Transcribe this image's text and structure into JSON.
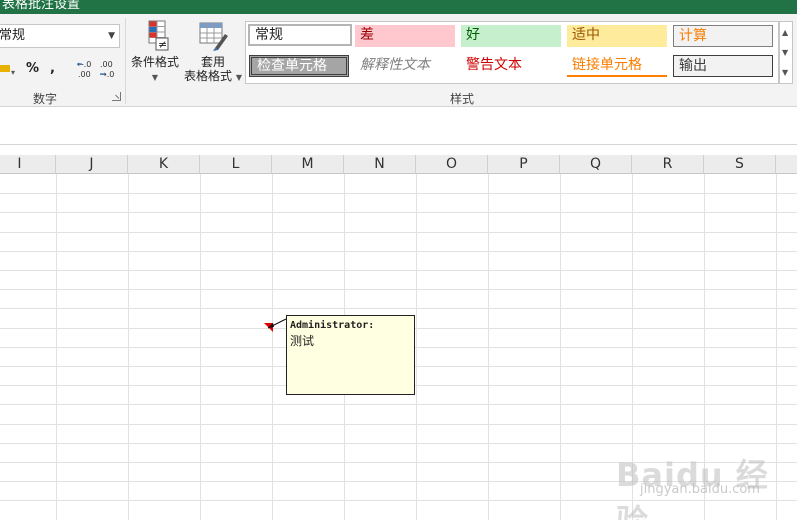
{
  "window": {
    "title": "表格批注设置"
  },
  "ribbon": {
    "number_format": "常规",
    "number_group_label": "数字",
    "percent_symbol": "%",
    "comma_symbol": ",",
    "cond_format_label": "条件格式",
    "table_format_label_1": "套用",
    "table_format_label_2": "表格格式",
    "styles_group_label": "样式",
    "styles": [
      {
        "label": "常规"
      },
      {
        "label": "差"
      },
      {
        "label": "好"
      },
      {
        "label": "适中"
      },
      {
        "label": "计算"
      },
      {
        "label": "检查单元格"
      },
      {
        "label": "解释性文本"
      },
      {
        "label": "警告文本"
      },
      {
        "label": "链接单元格"
      },
      {
        "label": "输出"
      }
    ]
  },
  "grid": {
    "columns": [
      "I",
      "J",
      "K",
      "L",
      "M",
      "N",
      "O",
      "P",
      "Q",
      "R",
      "S"
    ]
  },
  "comment": {
    "author": "Administrator:",
    "text": "测试"
  },
  "watermark": {
    "brand": "Baidu 经验",
    "url": "jingyan.baidu.com"
  },
  "colors": {
    "excel_green": "#217346",
    "bad_fill": "#ffc7ce",
    "bad_text": "#9c0006",
    "good_fill": "#c6efce",
    "good_text": "#006100",
    "neutral_fill": "#ffeb9c",
    "neutral_text": "#9c5700",
    "calc_text": "#fa7d00",
    "comment_fill": "#ffffe1",
    "comment_marker": "#e00000"
  }
}
